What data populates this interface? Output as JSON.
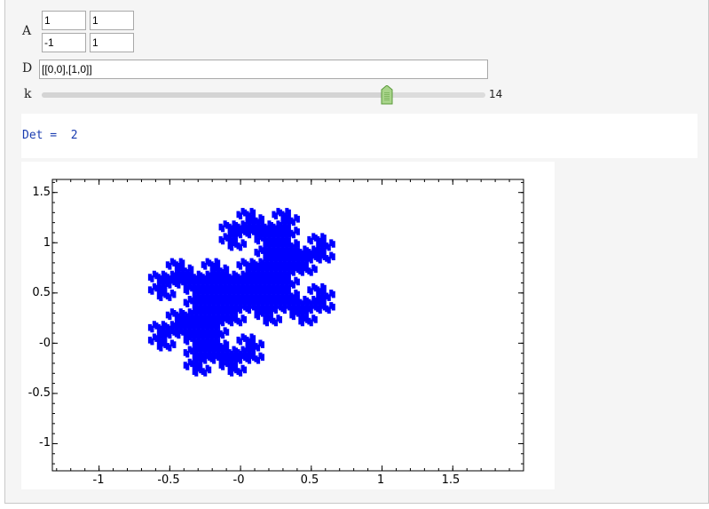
{
  "controls": {
    "A_label": "A",
    "A_matrix": [
      "1",
      "1",
      "-1",
      "1"
    ],
    "D_label": "D",
    "D_value": "[[0,0],[1,0]]",
    "k_label": "k",
    "k_value": "14",
    "k_fraction": 0.778
  },
  "output": {
    "det_text": "Det =  2"
  },
  "chart_data": {
    "type": "scatter",
    "title": "",
    "xlabel": "",
    "ylabel": "",
    "xlim": [
      -1.33,
      2.0
    ],
    "ylim": [
      -1.27,
      1.63
    ],
    "x_ticks": [
      "-1",
      "-0.5",
      "-0",
      "0.5",
      "1",
      "1.5"
    ],
    "y_ticks": [
      "1.5",
      "1",
      "0.5",
      "-0",
      "-0.5",
      "-1"
    ],
    "color": "#0000ff",
    "description_series": "Twin-dragon fractal set generated by matrix A=[[1,1],[-1,1]] with digits D=[[0,0],[1,0]], k=14 iterations"
  }
}
